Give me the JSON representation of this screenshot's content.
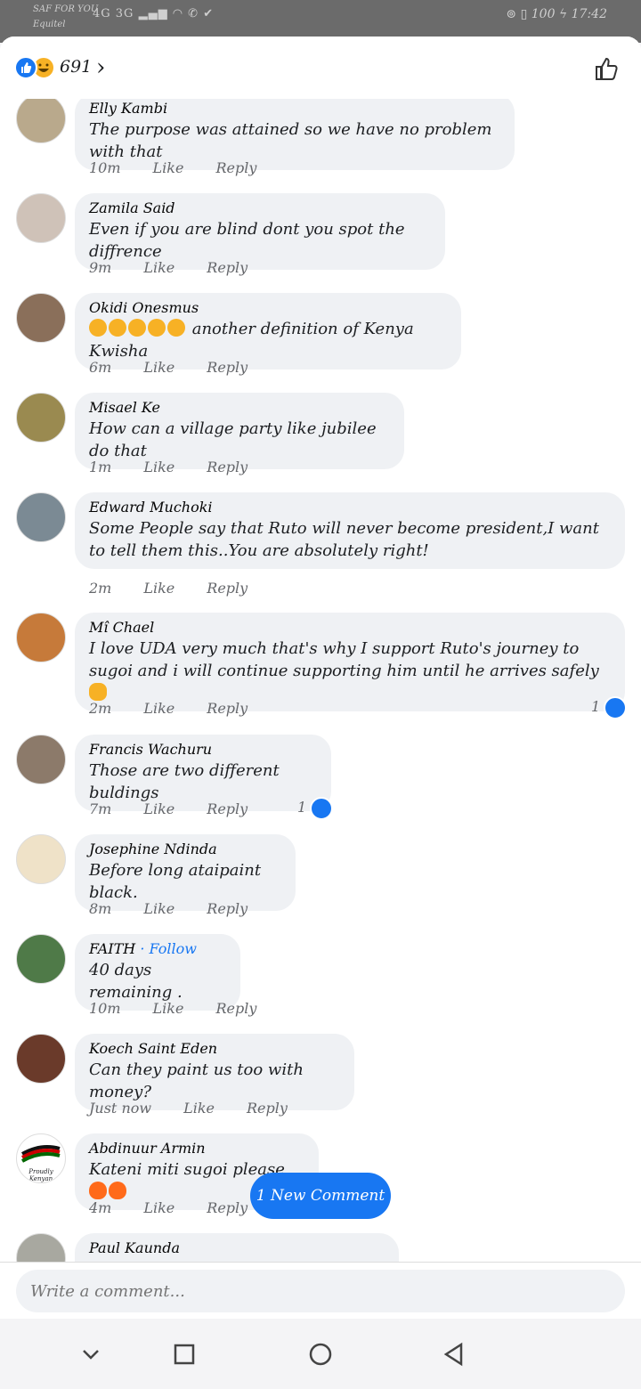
{
  "status_bar": {
    "carrier_line1": "SAF FOR YOU",
    "carrier_line2": "Equitel",
    "signal": "4G 3G",
    "battery": "100",
    "time": "17:42"
  },
  "header": {
    "reaction_count": "691"
  },
  "comments": [
    {
      "name": "Elly Kambi",
      "text": "The purpose was attained so we have no problem with that",
      "time": "10m",
      "like": "Like",
      "reply": "Reply"
    },
    {
      "name": "Zamila Said",
      "text": "Even if you are blind dont you spot the diffrence",
      "time": "9m",
      "like": "Like",
      "reply": "Reply"
    },
    {
      "name": "Okidi Onesmus",
      "text": "another definition of Kenya Kwisha",
      "time": "6m",
      "like": "Like",
      "reply": "Reply"
    },
    {
      "name": "Misael Ke",
      "text": "How can a village party like jubilee do that",
      "time": "1m",
      "like": "Like",
      "reply": "Reply"
    },
    {
      "name": "Edward Muchoki",
      "text": "Some People say that Ruto will never become president,I want to tell them this..You are absolutely right!",
      "time": "2m",
      "like": "Like",
      "reply": "Reply"
    },
    {
      "name": "Mî Chael",
      "text": "I love UDA very much that's why I support Ruto's journey to sugoi and i will continue supporting him until he arrives safely",
      "time": "2m",
      "like": "Like",
      "reply": "Reply",
      "likes": "1"
    },
    {
      "name": "Francis Wachuru",
      "text": "Those are two different buldings",
      "time": "7m",
      "like": "Like",
      "reply": "Reply",
      "likes": "1"
    },
    {
      "name": "Josephine Ndinda",
      "text": "Before long ataipaint black.",
      "time": "8m",
      "like": "Like",
      "reply": "Reply"
    },
    {
      "name": "FAITH",
      "follow": "· Follow",
      "text": "40 days remaining .",
      "time": "10m",
      "like": "Like",
      "reply": "Reply"
    },
    {
      "name": "Koech Saint Eden",
      "text": "Can they paint us  too with money?",
      "time": "Just now",
      "like": "Like",
      "reply": "Reply"
    },
    {
      "name": "Abdinuur Armin",
      "text": "Kateni miti sugoi please",
      "time": "4m",
      "like": "Like",
      "reply": "Reply",
      "avatar_text": "Proudly Kenyan"
    },
    {
      "name": "Paul Kaunda",
      "text": ""
    }
  ],
  "new_comment_button": "1 New Comment",
  "composer": {
    "placeholder": "Write a comment..."
  },
  "icons": {
    "like": "like-icon",
    "haha": "haha-icon",
    "chevron": "chevron-right-icon",
    "thumb": "thumbs-up-icon",
    "nav": [
      "back-chevron-icon",
      "recents-square-icon",
      "home-circle-icon",
      "back-triangle-icon"
    ]
  },
  "colors": {
    "accent": "#1877f2",
    "bubble": "#eff1f4",
    "meta": "#65676b"
  }
}
